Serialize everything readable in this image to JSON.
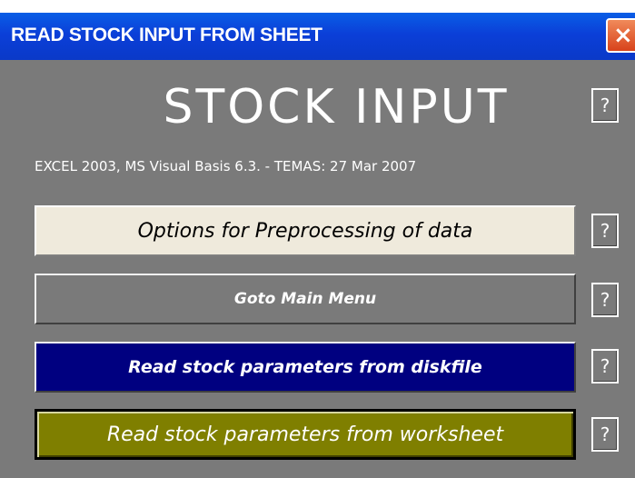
{
  "window": {
    "title": "READ STOCK INPUT FROM SHEET",
    "close_glyph": "×"
  },
  "main": {
    "heading": "STOCK INPUT",
    "version_text": "EXCEL 2003, MS Visual Basis 6.3. - TEMAS: 27 Mar 2007"
  },
  "buttons": {
    "options_label": "Options for Preprocessing of data",
    "goto_label": "Goto Main Menu",
    "disk_label": "Read  stock parameters from diskfile",
    "sheet_label": "Read stock parameters from worksheet"
  },
  "help": {
    "label": "?"
  },
  "colors": {
    "title_bar": "#0b3fd8",
    "dialog_bg": "#7a7a7a",
    "options_bg": "#efeadc",
    "disk_bg": "#000080",
    "sheet_bg": "#7f7f00",
    "close_bg": "#d8431b"
  }
}
